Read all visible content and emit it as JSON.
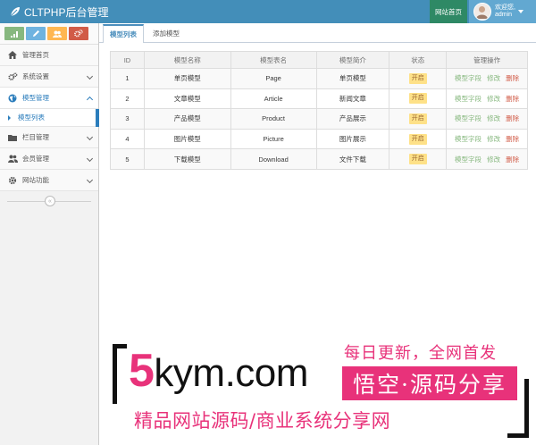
{
  "header": {
    "brand": "CLTPHP后台管理",
    "site_home": "网站首页",
    "welcome": "欢迎您,",
    "username": "admin"
  },
  "sidebar": {
    "shortcuts": [
      {
        "icon": "signal-icon",
        "color": "#87b87f"
      },
      {
        "icon": "pencil-icon",
        "color": "#6fb3e0"
      },
      {
        "icon": "users-icon",
        "color": "#ffb752"
      },
      {
        "icon": "cogs-icon",
        "color": "#d15b47"
      }
    ],
    "items": [
      {
        "label": "管理首页",
        "icon": "home-icon"
      },
      {
        "label": "系统设置",
        "icon": "cogs-icon"
      },
      {
        "label": "模型管理",
        "icon": "globe-icon"
      },
      {
        "label": "模型列表",
        "icon": "caret-right-icon"
      },
      {
        "label": "栏目管理",
        "icon": "folder-icon"
      },
      {
        "label": "会员管理",
        "icon": "users-icon"
      },
      {
        "label": "网站功能",
        "icon": "gear-icon"
      }
    ],
    "collapse_glyph": "«"
  },
  "tabs": [
    {
      "label": "模型列表",
      "active": true
    },
    {
      "label": "添加模型",
      "active": false
    }
  ],
  "table": {
    "columns": [
      "ID",
      "模型名称",
      "模型表名",
      "模型简介",
      "状态",
      "管理操作"
    ],
    "rows": [
      {
        "id": "1",
        "name": "单页模型",
        "table": "Page",
        "desc": "单页模型",
        "status": "开启"
      },
      {
        "id": "2",
        "name": "文章模型",
        "table": "Article",
        "desc": "新闻文章",
        "status": "开启"
      },
      {
        "id": "3",
        "name": "产品模型",
        "table": "Product",
        "desc": "产品展示",
        "status": "开启"
      },
      {
        "id": "4",
        "name": "图片模型",
        "table": "Picture",
        "desc": "图片展示",
        "status": "开启"
      },
      {
        "id": "5",
        "name": "下载模型",
        "table": "Download",
        "desc": "文件下载",
        "status": "开启"
      }
    ],
    "actions": {
      "fields": "模型字段",
      "edit": "修改",
      "delete": "删除"
    }
  },
  "watermark": {
    "slogan": "每日更新，全网首发",
    "domain_digit": "5",
    "domain_rest": "kym.com",
    "box": "悟空·源码分享",
    "footer": "精品网站源码/商业系统分享网"
  },
  "colors": {
    "navbar": "#438eb9",
    "site_home_bg": "#2e8965",
    "active_blue": "#2b7dbc",
    "badge_bg": "#fee188",
    "action_green": "#87b87f",
    "action_red": "#d15b47",
    "watermark_pink": "#e8327a"
  }
}
